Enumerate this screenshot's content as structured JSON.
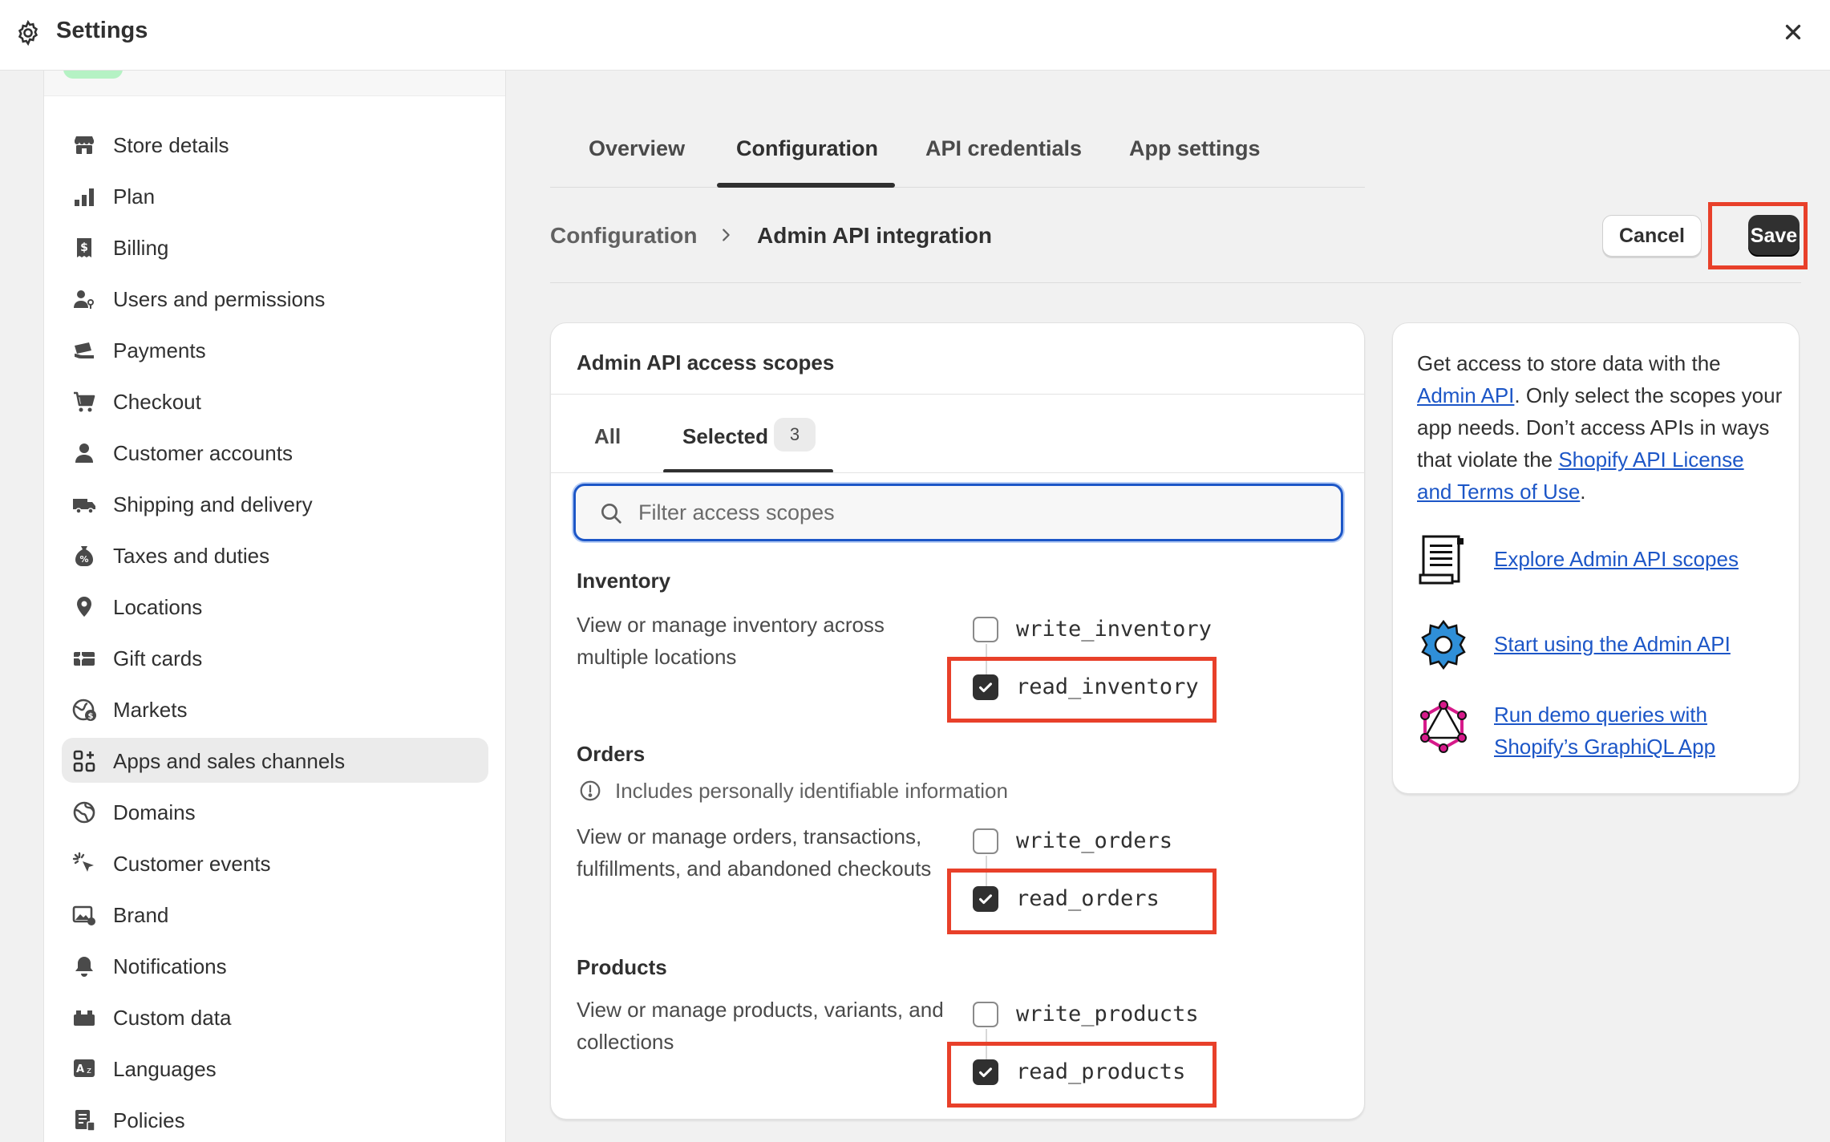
{
  "window": {
    "title": "Settings",
    "close_icon": "close-icon",
    "settings_icon": "gear-icon"
  },
  "sidebar": {
    "items": [
      {
        "label": "Store details",
        "icon": "store-icon",
        "active": false
      },
      {
        "label": "Plan",
        "icon": "plan-icon",
        "active": false
      },
      {
        "label": "Billing",
        "icon": "billing-icon",
        "active": false
      },
      {
        "label": "Users and permissions",
        "icon": "users-icon",
        "active": false
      },
      {
        "label": "Payments",
        "icon": "payments-icon",
        "active": false
      },
      {
        "label": "Checkout",
        "icon": "cart-icon",
        "active": false
      },
      {
        "label": "Customer accounts",
        "icon": "person-icon",
        "active": false
      },
      {
        "label": "Shipping and delivery",
        "icon": "truck-icon",
        "active": false
      },
      {
        "label": "Taxes and duties",
        "icon": "tax-icon",
        "active": false
      },
      {
        "label": "Locations",
        "icon": "location-icon",
        "active": false
      },
      {
        "label": "Gift cards",
        "icon": "gift-card-icon",
        "active": false
      },
      {
        "label": "Markets",
        "icon": "globe-dollar-icon",
        "active": false
      },
      {
        "label": "Apps and sales channels",
        "icon": "apps-icon",
        "active": true
      },
      {
        "label": "Domains",
        "icon": "globe-icon",
        "active": false
      },
      {
        "label": "Customer events",
        "icon": "cursor-click-icon",
        "active": false
      },
      {
        "label": "Brand",
        "icon": "brand-image-icon",
        "active": false
      },
      {
        "label": "Notifications",
        "icon": "bell-icon",
        "active": false
      },
      {
        "label": "Custom data",
        "icon": "blocks-icon",
        "active": false
      },
      {
        "label": "Languages",
        "icon": "language-icon",
        "active": false
      },
      {
        "label": "Policies",
        "icon": "policy-icon",
        "active": false
      }
    ]
  },
  "tabs": [
    {
      "label": "Overview",
      "active": false
    },
    {
      "label": "Configuration",
      "active": true
    },
    {
      "label": "API credentials",
      "active": false
    },
    {
      "label": "App settings",
      "active": false
    }
  ],
  "breadcrumb": {
    "parent": "Configuration",
    "current": "Admin API integration"
  },
  "actions": {
    "cancel": "Cancel",
    "save": "Save"
  },
  "scopes_card": {
    "title": "Admin API access scopes",
    "tab_all": "All",
    "tab_selected": "Selected",
    "selected_count": "3",
    "search_placeholder": "Filter access scopes",
    "sections": [
      {
        "title": "Inventory",
        "description": "View or manage inventory across multiple locations",
        "note": "",
        "scopes": [
          {
            "name": "write_inventory",
            "checked": false
          },
          {
            "name": "read_inventory",
            "checked": true
          }
        ]
      },
      {
        "title": "Orders",
        "description": "View or manage orders, transactions, fulfillments, and abandoned checkouts",
        "note": "Includes personally identifiable information",
        "scopes": [
          {
            "name": "write_orders",
            "checked": false
          },
          {
            "name": "read_orders",
            "checked": true
          }
        ]
      },
      {
        "title": "Products",
        "description": "View or manage products, variants, and collections",
        "note": "",
        "scopes": [
          {
            "name": "write_products",
            "checked": false
          },
          {
            "name": "read_products",
            "checked": true
          }
        ]
      }
    ]
  },
  "help_card": {
    "text_1": "Get access to store data with the ",
    "link_admin_api": "Admin API",
    "text_2": ". Only select the scopes your app needs. Don’t access APIs in ways that violate the ",
    "link_terms": "Shopify API License and Terms of Use",
    "text_3": ".",
    "links": [
      {
        "label": "Explore Admin API scopes",
        "icon": "scroll-document-icon"
      },
      {
        "label": "Start using the Admin API",
        "icon": "blue-gear-icon"
      },
      {
        "label": "Run demo queries with Shopify’s GraphiQL App",
        "icon": "graphql-icon"
      }
    ]
  },
  "colors": {
    "highlight": "#e8402a",
    "link": "#1c56c7",
    "primary_button": "#303030",
    "focus_border": "#1c56c7"
  }
}
